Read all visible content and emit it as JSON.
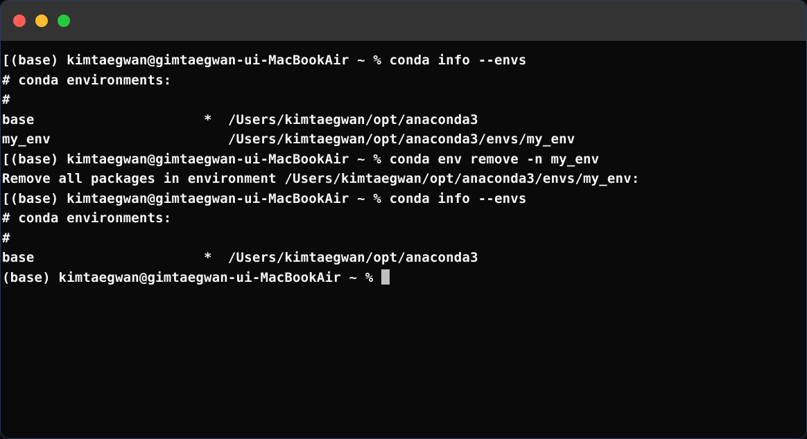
{
  "titlebar": {
    "close": "close",
    "minimize": "minimize",
    "maximize": "maximize"
  },
  "session": {
    "prompt_prefix": "[(base) kimtaegwan@gimtaegwan-ui-MacBookAir ~ % ",
    "prompt_prefix_plain": "(base) kimtaegwan@gimtaegwan-ui-MacBookAir ~ % ",
    "blocks": [
      {
        "command": "conda info --envs",
        "output_header1": "# conda environments:",
        "output_header2": "#",
        "envs": [
          {
            "name": "base",
            "active": "*",
            "path": "/Users/kimtaegwan/opt/anaconda3"
          },
          {
            "name": "my_env",
            "active": " ",
            "path": "/Users/kimtaegwan/opt/anaconda3/envs/my_env"
          }
        ]
      },
      {
        "command": "conda env remove -n my_env",
        "output_line": "Remove all packages in environment /Users/kimtaegwan/opt/anaconda3/envs/my_env:"
      },
      {
        "command": "conda info --envs",
        "output_header1": "# conda environments:",
        "output_header2": "#",
        "envs": [
          {
            "name": "base",
            "active": "*",
            "path": "/Users/kimtaegwan/opt/anaconda3"
          }
        ]
      }
    ],
    "blank": ""
  }
}
